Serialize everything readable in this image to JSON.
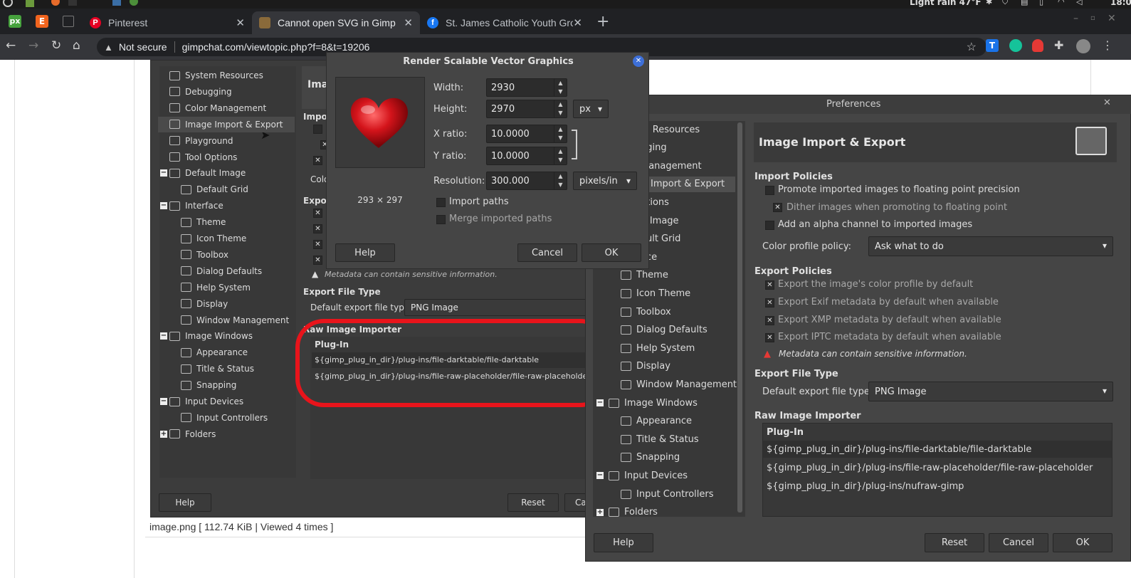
{
  "browser": {
    "tabs": [
      {
        "label": "Pinterest"
      },
      {
        "label": "Cannot open SVG in Gimp • Gi"
      },
      {
        "label": "St. James Catholic Youth Grou"
      }
    ],
    "security_label": "Not secure",
    "url": "gimpchat.com/viewtopic.php?f=8&t=19206",
    "weather": "Light rain 47°F",
    "clock": "18:0"
  },
  "page": {
    "caption": "image.png [ 112.74 KiB | Viewed 4 times ]"
  },
  "back_prefs": {
    "tree": [
      {
        "label": "System Resources"
      },
      {
        "label": "Debugging"
      },
      {
        "label": "Color Management"
      },
      {
        "label": "Image Import & Export"
      },
      {
        "label": "Playground"
      },
      {
        "label": "Tool Options"
      },
      {
        "label": "Default Image"
      },
      {
        "label": "Default Grid"
      },
      {
        "label": "Interface"
      },
      {
        "label": "Theme"
      },
      {
        "label": "Icon Theme"
      },
      {
        "label": "Toolbox"
      },
      {
        "label": "Dialog Defaults"
      },
      {
        "label": "Help System"
      },
      {
        "label": "Display"
      },
      {
        "label": "Window Management"
      },
      {
        "label": "Image Windows"
      },
      {
        "label": "Appearance"
      },
      {
        "label": "Title & Status"
      },
      {
        "label": "Snapping"
      },
      {
        "label": "Input Devices"
      },
      {
        "label": "Input Controllers"
      },
      {
        "label": "Folders"
      }
    ],
    "title": "Imag",
    "import_hdr": "Impor",
    "color_lbl": "Colo",
    "export_hdr": "Expor",
    "metadata_warning": "Metadata can contain sensitive information.",
    "export_file_type_hdr": "Export File Type",
    "default_export_label": "Default export file type:",
    "default_export_value": "PNG Image",
    "raw_hdr": "Raw Image Importer",
    "plugin_col": "Plug-In",
    "plugins": [
      "${gimp_plug_in_dir}/plug-ins/file-darktable/file-darktable",
      "${gimp_plug_in_dir}/plug-ins/file-raw-placeholder/file-raw-placeholder"
    ],
    "help": "Help",
    "reset": "Reset",
    "cancel_partial": "Ca"
  },
  "svg_dialog": {
    "title": "Render Scalable Vector Graphics",
    "preview_size": "293 × 297",
    "width_label": "Width:",
    "width": "2930",
    "height_label": "Height:",
    "height": "2970",
    "unit": "px",
    "xratio_label": "X ratio:",
    "xratio": "10.0000",
    "yratio_label": "Y ratio:",
    "yratio": "10.0000",
    "resolution_label": "Resolution:",
    "resolution": "300.000",
    "res_unit": "pixels/in",
    "import_paths": "Import paths",
    "merge_paths": "Merge imported paths",
    "help": "Help",
    "cancel": "Cancel",
    "ok": "OK"
  },
  "prefs": {
    "window_title": "Preferences",
    "tree": [
      {
        "label": "m Resources"
      },
      {
        "label": "gging"
      },
      {
        "label": "Management"
      },
      {
        "label": " Import & Export"
      },
      {
        "label": "ptions"
      },
      {
        "label": "lt Image"
      },
      {
        "label": "ault Grid"
      },
      {
        "label": "ace"
      },
      {
        "label": "Theme"
      },
      {
        "label": "Icon Theme"
      },
      {
        "label": "Toolbox"
      },
      {
        "label": "Dialog Defaults"
      },
      {
        "label": "Help System"
      },
      {
        "label": "Display"
      },
      {
        "label": "Window Management"
      },
      {
        "label": "Image Windows"
      },
      {
        "label": "Appearance"
      },
      {
        "label": "Title & Status"
      },
      {
        "label": "Snapping"
      },
      {
        "label": "Input Devices"
      },
      {
        "label": "Input Controllers"
      },
      {
        "label": "Folders"
      }
    ],
    "section_title": "Image Import & Export",
    "import_hdr": "Import Policies",
    "promote": "Promote imported images to floating point precision",
    "dither": "Dither images when promoting to floating point",
    "alpha": "Add an alpha channel to imported images",
    "color_policy_label": "Color profile policy:",
    "color_policy_value": "Ask what to do",
    "export_hdr": "Export Policies",
    "exp_color": "Export the image's color profile by default",
    "exp_exif": "Export Exif metadata by default when available",
    "exp_xmp": "Export XMP metadata by default when available",
    "exp_iptc": "Export IPTC metadata by default when available",
    "metadata_warning": "Metadata can contain sensitive information.",
    "export_file_type_hdr": "Export File Type",
    "default_export_label": "Default export file type:",
    "default_export_value": "PNG Image",
    "raw_hdr": "Raw Image Importer",
    "plugin_col": "Plug-In",
    "plugins": [
      "${gimp_plug_in_dir}/plug-ins/file-darktable/file-darktable",
      "${gimp_plug_in_dir}/plug-ins/file-raw-placeholder/file-raw-placeholder",
      "${gimp_plug_in_dir}/plug-ins/nufraw-gimp"
    ],
    "help": "Help",
    "reset": "Reset",
    "cancel": "Cancel",
    "ok": "OK"
  }
}
